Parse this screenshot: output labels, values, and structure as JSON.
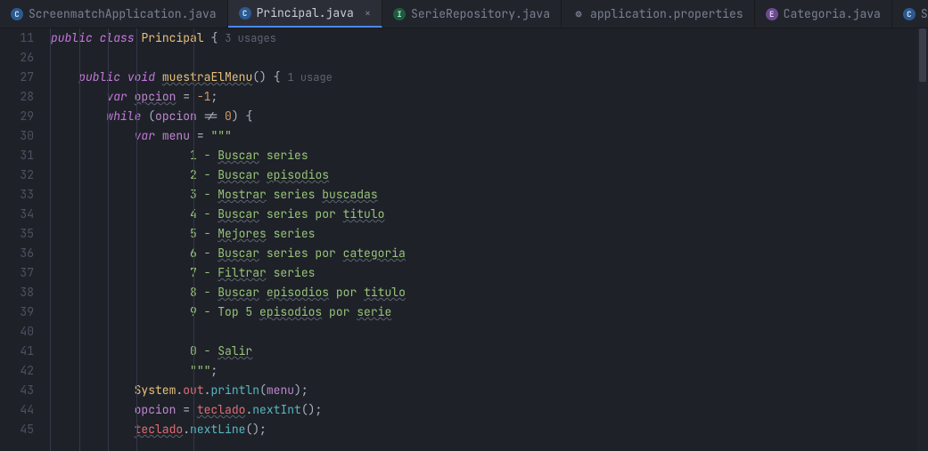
{
  "tabs": [
    {
      "label": "ScreenmatchApplication.java",
      "icon": "C",
      "iconClass": "icon-c",
      "active": false
    },
    {
      "label": "Principal.java",
      "icon": "C",
      "iconClass": "icon-c",
      "active": true
    },
    {
      "label": "SerieRepository.java",
      "icon": "I",
      "iconClass": "icon-i",
      "active": false
    },
    {
      "label": "application.properties",
      "icon": "⚙",
      "iconClass": "icon-gear",
      "active": false
    },
    {
      "label": "Categoria.java",
      "icon": "E",
      "iconClass": "icon-e",
      "active": false
    },
    {
      "label": "Serie.java",
      "icon": "C",
      "iconClass": "icon-c",
      "active": false
    }
  ],
  "gutter": [
    "11",
    "26",
    "27",
    "28",
    "29",
    "30",
    "31",
    "32",
    "33",
    "34",
    "35",
    "36",
    "37",
    "38",
    "39",
    "40",
    "41",
    "42",
    "43",
    "44",
    "45"
  ],
  "hints": {
    "classUsages": "3 usages",
    "methodUsages": "1 usage"
  },
  "code": {
    "classDecl": {
      "public": "public",
      "class": "class",
      "name": "Principal",
      "brace": "{"
    },
    "methodDecl": {
      "public": "public",
      "void": "void",
      "name": "muestraElMenu",
      "parens": "()",
      "brace": "{"
    },
    "opcionDecl": {
      "var": "var",
      "name": "opcion",
      "eq": " = ",
      "val": "-1",
      "semi": ";"
    },
    "whileDecl": {
      "while": "while",
      "open": " (",
      "var": "opcion",
      "cmp": " != ",
      "zero": "0",
      "close": ") {",
      "brace": ""
    },
    "menuDecl": {
      "var": "var",
      "name": "menu",
      "eq": " = ",
      "quote": "\"\"\""
    },
    "menuLines": [
      "1 - Buscar series ",
      "2 - Buscar episodios",
      "3 - Mostrar series buscadas",
      "4 - Buscar series por titulo",
      "5 - Mejores series",
      "6 - Buscar series por categoria",
      "7 - Filtrar series",
      "8 - Buscar episodios por titulo",
      "9 - Top 5 episodios por serie"
    ],
    "menuBlank": "",
    "menuExit": "0 - Salir",
    "menuEnd": "\"\"\";",
    "printLine": {
      "sys": "System",
      "dot1": ".",
      "out": "out",
      "dot2": ".",
      "println": "println",
      "open": "(",
      "arg": "menu",
      "close": ");"
    },
    "readInt": {
      "lhs": "opcion",
      "eq": " = ",
      "obj": "teclado",
      "dot": ".",
      "call": "nextInt",
      "parens": "();"
    },
    "readLine": {
      "obj": "teclado",
      "dot": ".",
      "call": "nextLine",
      "parens": "();"
    }
  },
  "typoWords": [
    "Buscar",
    "episodios",
    "Mostrar",
    "buscadas",
    "titulo",
    "Mejores",
    "categoria",
    "Filtrar",
    "serie",
    "Salir",
    "opcion",
    "muestraElMenu",
    "teclado"
  ]
}
